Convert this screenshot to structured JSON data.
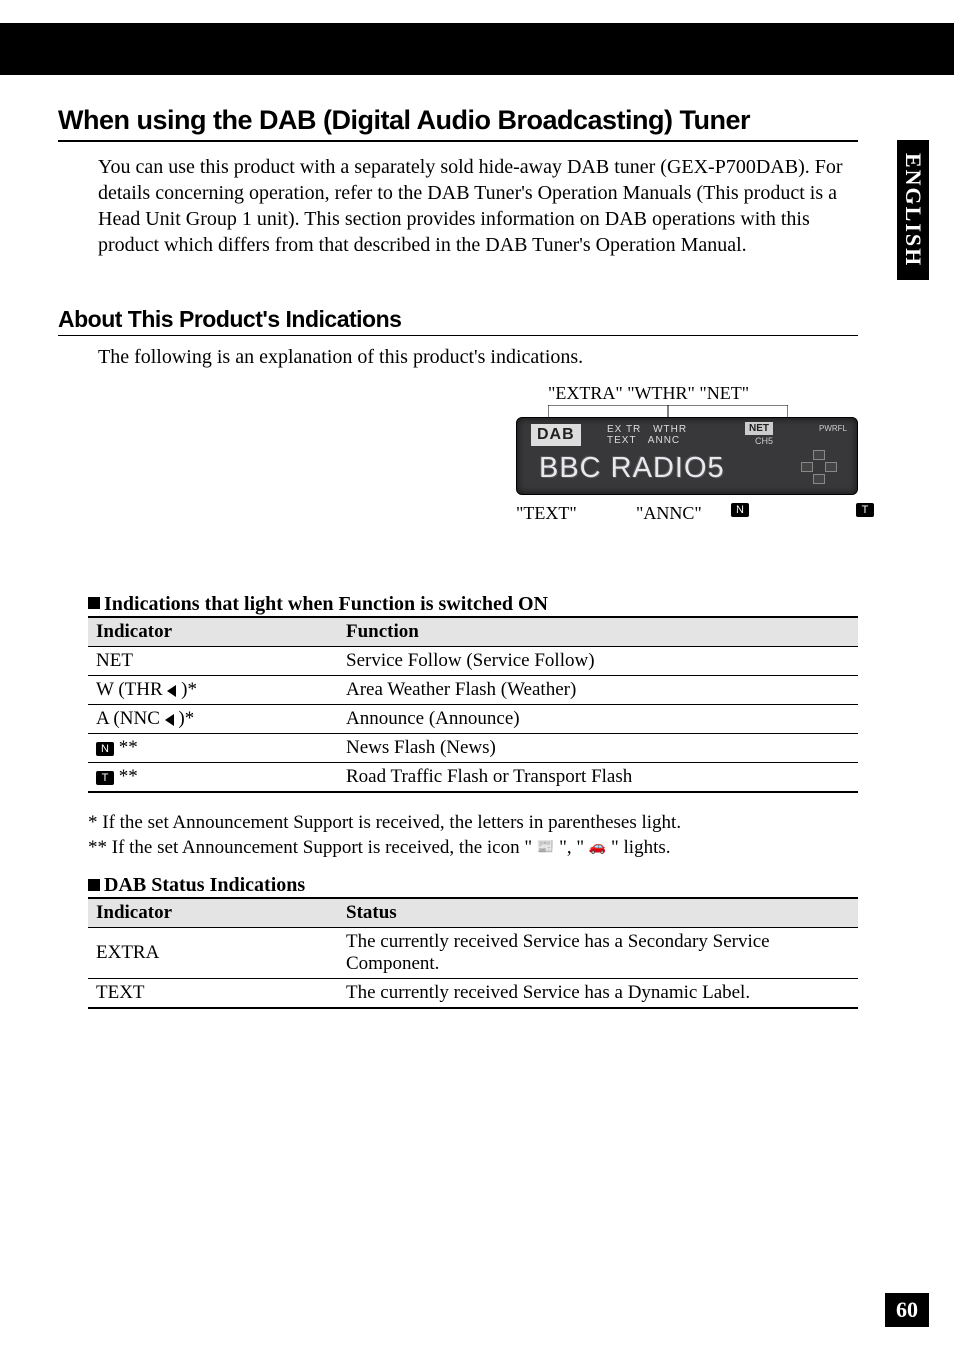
{
  "side_tab": "ENGLISH",
  "page_number": "60",
  "heading_main": "When using the DAB (Digital Audio Broadcasting) Tuner",
  "intro": "You can use this product with a separately sold hide-away DAB tuner (GEX-P700DAB). For details concerning operation, refer to the DAB Tuner's Operation Manuals (This product is a Head Unit Group 1 unit). This section provides information on DAB operations with this product which differs from that described in the DAB Tuner's Operation Manual.",
  "heading_sub": "About This Product's Indications",
  "sub_text": "The following is an explanation of this product's indications.",
  "display": {
    "top_labels": "\"EXTRA\" \"WTHR\" \"NET\"",
    "badge": "DAB",
    "row1_a": "EX TR",
    "row1_b": "WTHR",
    "row1_c": "TEXT",
    "row1_d": "ANNC",
    "net": "NET",
    "ch": "CH5",
    "pwrfl": "PWRFL",
    "station": "BBC RADIO5",
    "bottom_text": "\"TEXT\"",
    "bottom_annc": "\"ANNC\"",
    "bottom_n_pre": "\"",
    "bottom_n": "N",
    "bottom_n_post": "\"",
    "bottom_t_pre": "\"",
    "bottom_t": "T",
    "bottom_t_post": "\""
  },
  "sec1_title": "Indications that light when Function is switched ON",
  "table1": {
    "h1": "Indicator",
    "h2": "Function",
    "rows": [
      {
        "ind": "NET",
        "func": "Service Follow (Service Follow)"
      },
      {
        "ind": "W (THR ◀ )*",
        "func": "Area Weather Flash (Weather)",
        "tri": true
      },
      {
        "ind": "A (NNC ◀ )*",
        "func": "Announce (Announce)",
        "tri": true
      },
      {
        "ind": "N",
        "icon": true,
        "suffix": " **",
        "func": "News Flash (News)"
      },
      {
        "ind": "T",
        "icon": true,
        "suffix": " **",
        "func": "Road Traffic Flash or Transport Flash"
      }
    ]
  },
  "footnote1": "*   If the set Announcement Support is received, the letters in parentheses light.",
  "footnote2_a": "** If the set Announcement Support is received, the icon \" ",
  "footnote2_b": " \", \" ",
  "footnote2_c": " \" lights.",
  "sec2_title": "DAB Status Indications",
  "table2": {
    "h1": "Indicator",
    "h2": "Status",
    "rows": [
      {
        "ind": "EXTRA",
        "stat": "The currently received Service has a Secondary Service Component."
      },
      {
        "ind": "TEXT",
        "stat": "The currently received Service has a Dynamic Label."
      }
    ]
  }
}
